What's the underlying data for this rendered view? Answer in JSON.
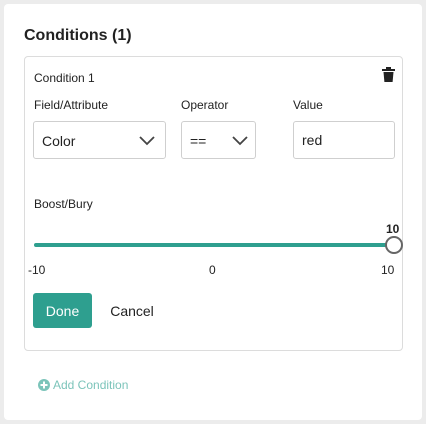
{
  "panel": {
    "title": "Conditions (1)"
  },
  "condition": {
    "label": "Condition 1",
    "field": {
      "label": "Field/Attribute",
      "value": "Color"
    },
    "operator": {
      "label": "Operator",
      "value": "=="
    },
    "value": {
      "label": "Value",
      "value": "red"
    },
    "boost": {
      "label": "Boost/Bury",
      "current": "10",
      "min_label": "-10",
      "mid_label": "0",
      "max_label": "10",
      "level_fraction": 1.0
    },
    "done_label": "Done",
    "cancel_label": "Cancel"
  },
  "add_condition_label": "Add Condition",
  "icons": {
    "trash": "trash-icon",
    "chevron": "chevron-down-icon",
    "add": "plus-circle-icon"
  },
  "colors": {
    "accent": "#2e9f8f",
    "accent_light": "#7cc4ba"
  }
}
